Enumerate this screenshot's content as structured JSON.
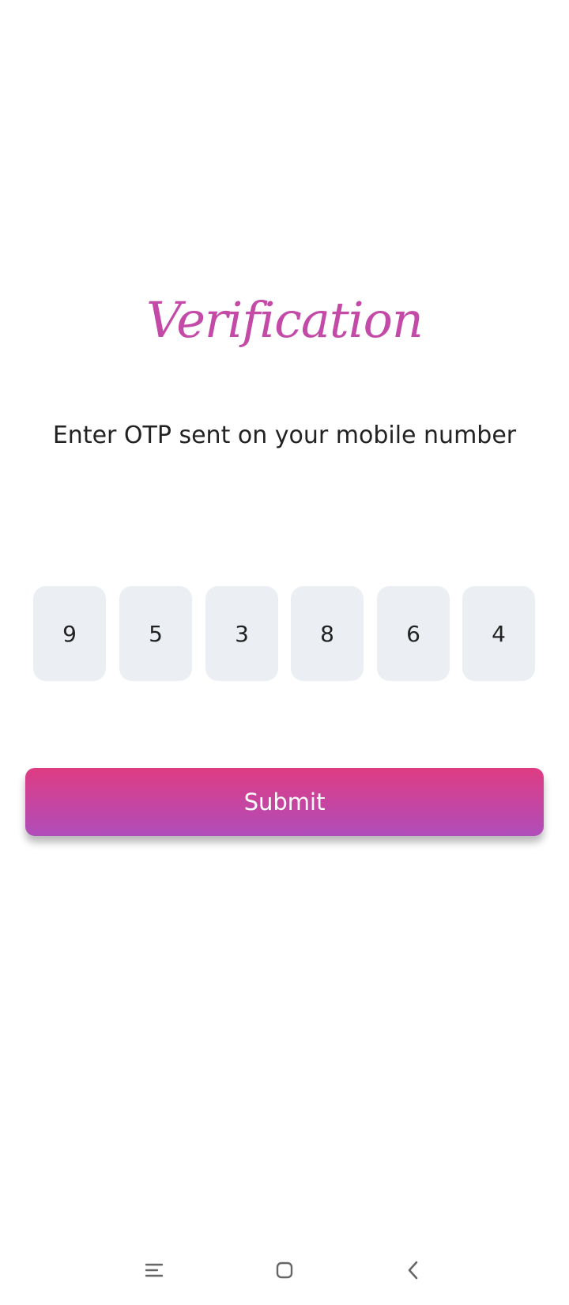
{
  "screen": {
    "title": "Verification",
    "subtitle": "Enter OTP sent on your mobile number"
  },
  "otp": {
    "digits": [
      "9",
      "5",
      "3",
      "8",
      "6",
      "4"
    ]
  },
  "actions": {
    "submit_label": "Submit"
  },
  "colors": {
    "title": "#c44aa8",
    "button_gradient_top": "#de3c82",
    "button_gradient_bottom": "#b04dbb",
    "otp_box_bg": "#ebeff3"
  },
  "system_nav": {
    "icons": [
      "menu-icon",
      "home-icon",
      "back-icon"
    ]
  }
}
